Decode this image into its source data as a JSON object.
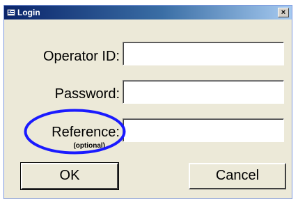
{
  "window": {
    "title": "Login",
    "close_label": "×"
  },
  "form": {
    "operator_label": "Operator ID:",
    "operator_value": "",
    "password_label": "Password:",
    "password_value": "",
    "reference_label": "Reference:",
    "reference_note": "(optional)",
    "reference_value": ""
  },
  "buttons": {
    "ok_label": "OK",
    "cancel_label": "Cancel"
  },
  "colors": {
    "titlebar_start": "#0a246a",
    "titlebar_end": "#a6caf0",
    "dialog_face": "#ece9d8",
    "highlight_ring": "#1a1aff"
  },
  "icons": {
    "window_icon": "login-window-icon",
    "close_icon": "close-icon"
  }
}
